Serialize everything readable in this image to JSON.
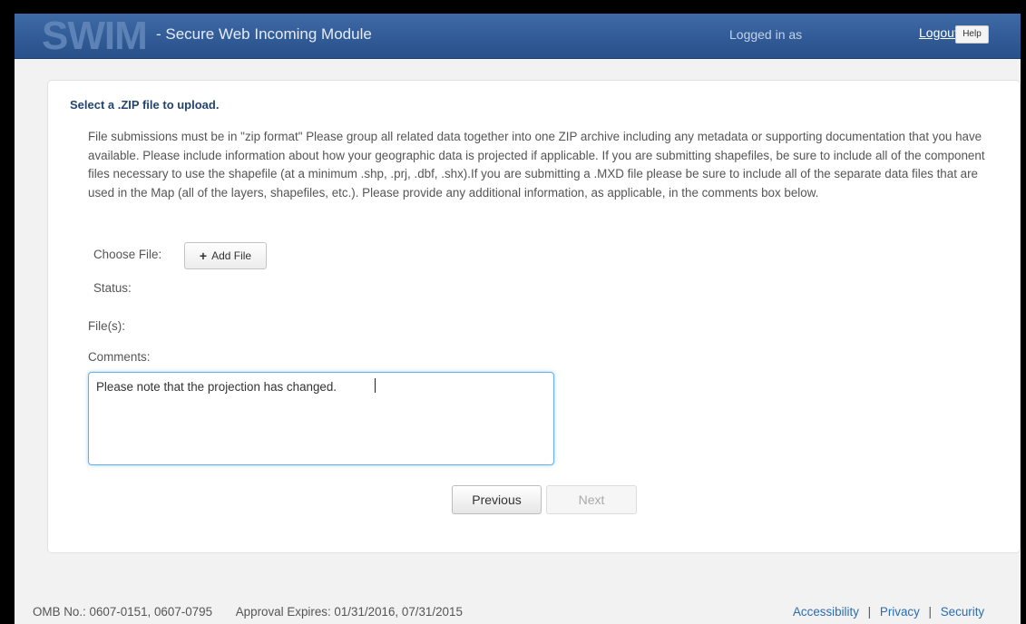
{
  "header": {
    "logo": "SWIM",
    "app_title": "- Secure Web Incoming Module",
    "logged_in_label": "Logged in as",
    "logout_label": "Logout",
    "help_label": "Help"
  },
  "form": {
    "heading": "Select a .ZIP file to upload.",
    "instructions": "File submissions must be in \"zip format\" Please group all related data together into one ZIP archive including any metadata or supporting documentation that you have available. Please include information about how your geographic data is projected if applicable. If you are submitting shapefiles, be sure to include all of the component files necessary to use the shapefile (at a minimum .shp, .prj, .dbf, .shx).If you are submitting a .MXD file please be sure to include all of the separate data files that are used in the Map (all of the layers, shapefiles, etc.). Please provide any additional information, as applicable, in the comments box below.",
    "choose_file_label": "Choose File:",
    "add_file_label": "Add File",
    "status_label": "Status:",
    "files_label": "File(s):",
    "comments_label": "Comments:",
    "comments_value": "Please note that the projection has changed.",
    "previous_label": "Previous",
    "next_label": "Next"
  },
  "footer": {
    "omb": "OMB No.: 0607-0151, 0607-0795",
    "approval": "Approval Expires: 01/31/2016, 07/31/2015",
    "links": [
      "Accessibility",
      "Privacy",
      "Security"
    ]
  },
  "colors": {
    "header_bg": "#30598f",
    "heading": "#24446f",
    "link": "#2a6db0",
    "focus_border": "#66afe9"
  }
}
